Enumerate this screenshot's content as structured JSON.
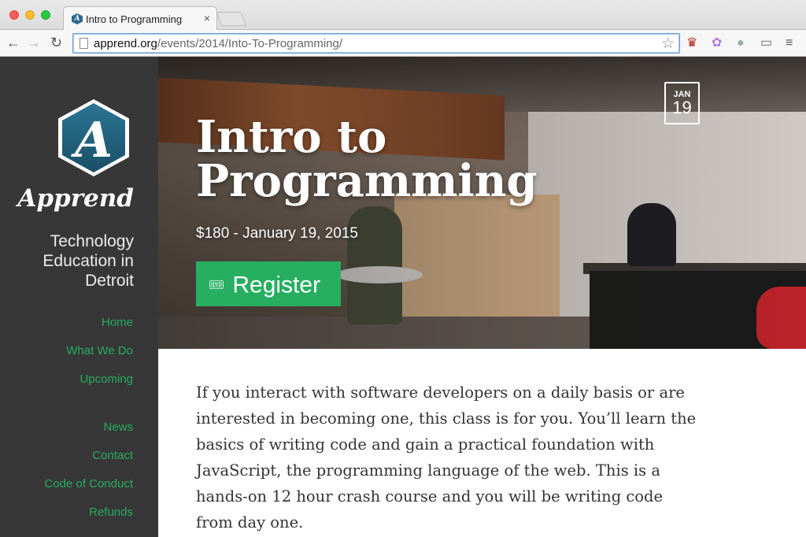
{
  "browser": {
    "tab_title": "Intro to Programming",
    "tab_close": "×",
    "url_host": "apprend.org",
    "url_path": "/events/2014/Into-To-Programming/",
    "back": "←",
    "forward": "→",
    "reload": "↻",
    "star": "☆",
    "extensions": [
      "♛",
      "✿",
      "●",
      "▭",
      "≡"
    ]
  },
  "sidebar": {
    "logo_letter": "A",
    "brand": "Apprend",
    "tagline_lines": [
      "Technology",
      "Education in",
      "Detroit"
    ],
    "nav": [
      "Home",
      "What We Do",
      "Upcoming",
      "News",
      "Contact",
      "Code of Conduct",
      "Refunds"
    ]
  },
  "hero": {
    "title": "Intro to Programming",
    "subtitle": "$180 - January 19, 2015",
    "register_icon": "🎟",
    "register_label": "Register",
    "date_month": "JAN",
    "date_day": "19"
  },
  "content": {
    "paragraph": "If you interact with software developers on a daily basis or are interested in becoming one, this class is for you. You’ll learn the basics of writing code and gain a practical foundation with JavaScript, the programming language of the web. This is a hands-on 12 hour crash course and you will be writing code from day one."
  },
  "colors": {
    "accent": "#27ae60",
    "sidebar_bg": "#373737",
    "logo_blue": "#2b7595"
  }
}
